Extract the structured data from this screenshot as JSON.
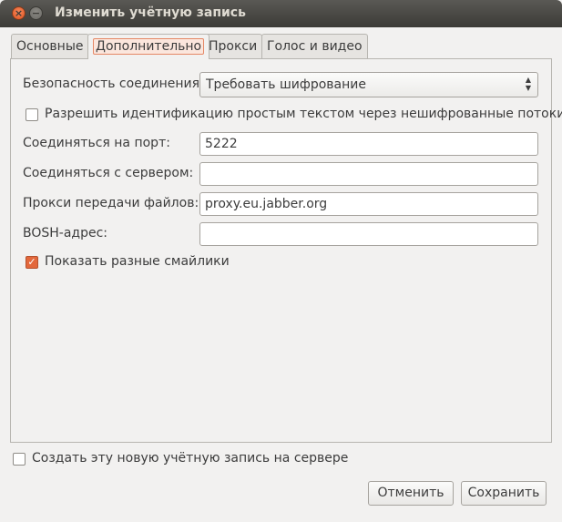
{
  "window": {
    "title": "Изменить учётную запись",
    "close_glyph": "×",
    "minimize_glyph": "−"
  },
  "tabs": [
    {
      "label": "Основные",
      "active": false
    },
    {
      "label": "Дополнительно",
      "active": true
    },
    {
      "label": "Прокси",
      "active": false
    },
    {
      "label": "Голос и видео",
      "active": false
    }
  ],
  "form": {
    "security_label": "Безопасность соединения:",
    "security_value": "Требовать шифрование",
    "plaintext_auth_label": "Разрешить идентификацию простым текстом через нешифрованные потоки",
    "plaintext_auth_checked": false,
    "port_label": "Соединяться на порт:",
    "port_value": "5222",
    "server_label": "Соединяться с сервером:",
    "server_value": "",
    "file_proxy_label": "Прокси передачи файлов:",
    "file_proxy_value": "proxy.eu.jabber.org",
    "bosh_label": "BOSH-адрес:",
    "bosh_value": "",
    "smileys_label": "Показать разные смайлики",
    "smileys_checked": true,
    "check_glyph": "✓"
  },
  "footer": {
    "create_on_server_label": "Создать эту новую учётную запись на сервере",
    "create_on_server_checked": false,
    "cancel_label": "Отменить",
    "save_label": "Сохранить"
  },
  "colors": {
    "accent": "#e3683c",
    "titlebar": "#3c3b37",
    "background": "#f2f1f0"
  }
}
